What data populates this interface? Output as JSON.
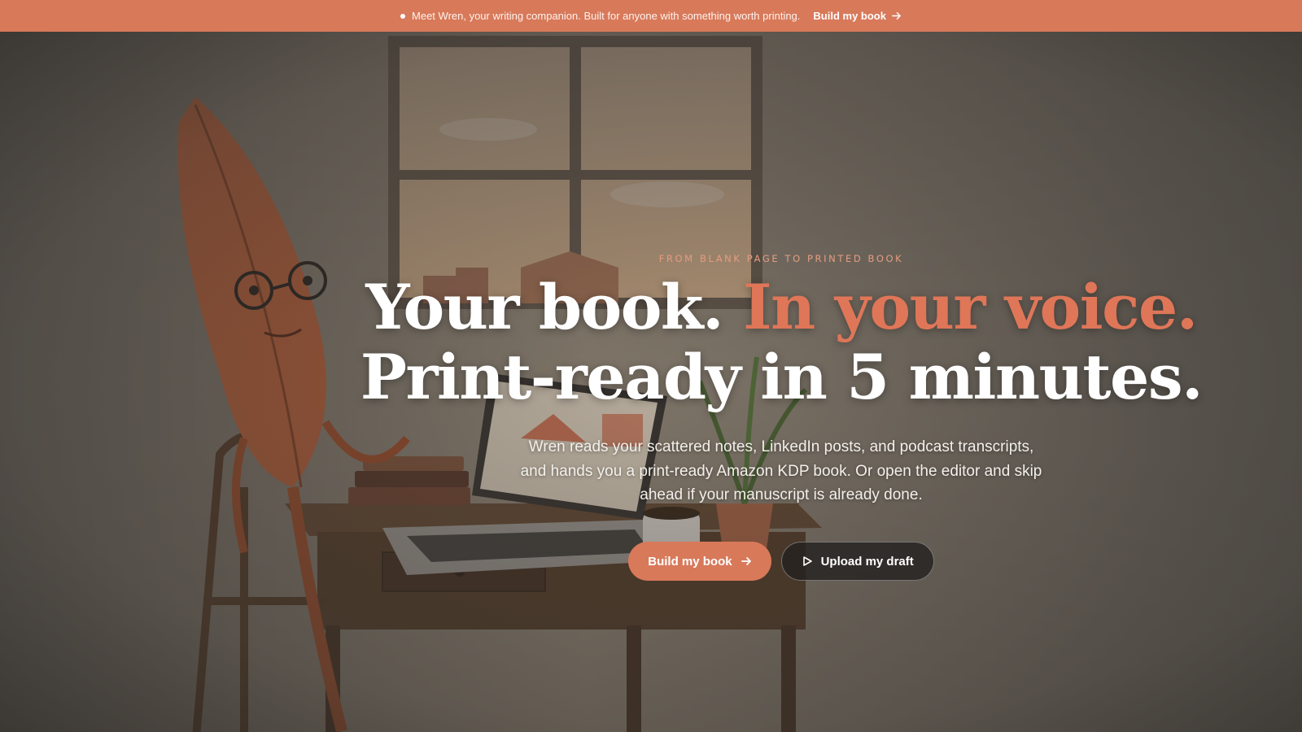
{
  "banner": {
    "message": "Meet Wren, your writing companion. Built for anyone with something worth printing.",
    "cta_label": "Build my book"
  },
  "hero": {
    "eyebrow": "FROM BLANK PAGE TO PRINTED BOOK",
    "headline_part1": "Your book. ",
    "headline_accent": "In your voice.",
    "headline_line2": "Print-ready in 5 minutes.",
    "subtitle": "Wren reads your scattered notes, LinkedIn posts, and podcast transcripts, and hands you a print-ready Amazon KDP book. Or open the editor and skip ahead if your manuscript is already done.",
    "primary_button": "Build my book",
    "secondary_button": "Upload my draft"
  },
  "colors": {
    "accent": "#d8795a",
    "headline_accent": "#df7658",
    "eyebrow": "#e59c80"
  },
  "icons": [
    "dot-icon",
    "arrow-right-icon",
    "play-icon"
  ]
}
